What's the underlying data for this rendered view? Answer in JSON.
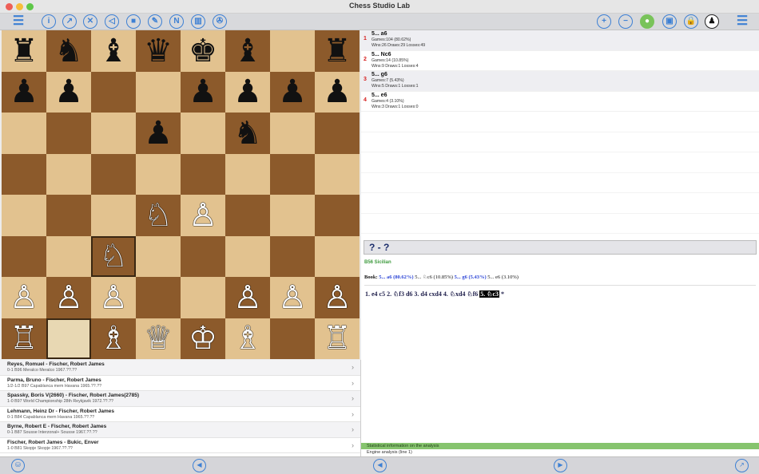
{
  "window": {
    "title": "Chess Studio Lab"
  },
  "toolbar": {
    "left": [
      {
        "name": "menu-icon",
        "glyph": "☰"
      },
      {
        "name": "info-icon",
        "glyph": "i"
      },
      {
        "name": "arrow-icon",
        "glyph": "↗"
      },
      {
        "name": "close-icon",
        "glyph": "✕"
      },
      {
        "name": "eraser-icon",
        "glyph": "◁"
      },
      {
        "name": "stop-icon",
        "glyph": "■"
      },
      {
        "name": "signature-icon",
        "glyph": "✎"
      },
      {
        "name": "notation-icon",
        "glyph": "N"
      },
      {
        "name": "book-icon",
        "glyph": "▥"
      },
      {
        "name": "wrench-icon",
        "glyph": "✇"
      }
    ],
    "right": [
      {
        "name": "zoom-in-icon",
        "glyph": "+"
      },
      {
        "name": "zoom-out-icon",
        "glyph": "−"
      },
      {
        "name": "engine-on-icon",
        "glyph": "●"
      },
      {
        "name": "window-icon",
        "glyph": "▣"
      },
      {
        "name": "lock-icon",
        "glyph": "🔒"
      },
      {
        "name": "pawn-icon",
        "glyph": "♟"
      },
      {
        "name": "sidebar-menu-icon",
        "glyph": "☰"
      }
    ]
  },
  "board": {
    "ranks": [
      [
        "♜",
        "♞",
        "♝",
        "♛",
        "♚",
        "♝",
        "",
        "♜"
      ],
      [
        "♟",
        "♟",
        "",
        "",
        "♟",
        "♟",
        "♟",
        "♟"
      ],
      [
        "",
        "",
        "",
        "♟",
        "",
        "♞",
        "",
        ""
      ],
      [
        "",
        "",
        "",
        "",
        "",
        "",
        "",
        ""
      ],
      [
        "",
        "",
        "",
        "♘",
        "♙",
        "",
        "",
        ""
      ],
      [
        "",
        "",
        "♘",
        "",
        "",
        "",
        "",
        ""
      ],
      [
        "♙",
        "♙",
        "♙",
        "",
        "",
        "♙",
        "♙",
        "♙"
      ],
      [
        "♖",
        "",
        "♗",
        "♕",
        "♔",
        "♗",
        "",
        "♖"
      ]
    ],
    "highlighted_squares": [
      "c3",
      "b1"
    ]
  },
  "games": [
    {
      "players": "Reyes, Romuel - Fischer, Robert James",
      "info": "0-1 B96 Meralco Meralco 1967.??.??"
    },
    {
      "players": "Parma, Bruno - Fischer, Robert James",
      "info": "1/2-1/2 B97 Capablanca mem Havana 1965.??.??"
    },
    {
      "players": "Spassky, Boris V(2660) - Fischer, Robert James(2785)",
      "info": "1-0 B97 World Championship 28th Reykjavik 1972.??.??"
    },
    {
      "players": "Lehmann, Heinz Dr - Fischer, Robert James",
      "info": "0-1 B84 Capablanca mem Havana 1965.??.??"
    },
    {
      "players": "Byrne, Robert E - Fischer, Robert James",
      "info": "0-1 B87 Sousse Interzonal+ Sousse 1967.??.??"
    },
    {
      "players": "Fischer, Robert James - Bukic, Enver",
      "info": "1-0 B81 Skopje Skopje 1967.??.??"
    }
  ],
  "book_moves": [
    {
      "num": "1",
      "move": "5... a6",
      "games": "Games:104 (80.62%)",
      "stats": "Wins:26 Draws:29 Losses:49"
    },
    {
      "num": "2",
      "move": "5... Nc6",
      "games": "Games:14 (10.85%)",
      "stats": "Wins:9 Draws:1 Losses:4"
    },
    {
      "num": "3",
      "move": "5... g6",
      "games": "Games:7 (5.43%)",
      "stats": "Wins:5 Draws:1 Losses:1"
    },
    {
      "num": "4",
      "move": "5... e6",
      "games": "Games:4 (3.10%)",
      "stats": "Wins:3 Draws:1 Losses:0"
    }
  ],
  "result": "? - ?",
  "eco": "B56 Sicilian",
  "book_line": {
    "label": "Book:",
    "a6": "5... a6 (80.62%)",
    "nc6": "5... ♘c6 (10.85%)",
    "g6": "5... g6 (5.43%)",
    "e6": "5... e6 (3.10%)"
  },
  "moves": {
    "text": "1. e4 c5 2. ♘f3 d6 3. d4 cxd4 4. ♘xd4 ♘f6",
    "current": "5. ♘c3",
    "tail": "*"
  },
  "status": {
    "stat": "Statistical information on the analysis",
    "engine": "Engine analysis (line 1)"
  },
  "bottom": [
    {
      "name": "database-icon",
      "glyph": "⛁"
    },
    {
      "name": "back-icon",
      "glyph": "◀"
    },
    {
      "name": "prev-icon",
      "glyph": "◀"
    },
    {
      "name": "next-icon",
      "glyph": "▶"
    },
    {
      "name": "share-icon",
      "glyph": "↗"
    }
  ],
  "colors": {
    "accent": "#3d80d4",
    "light_square": "#e2c28f",
    "dark_square": "#8c5a2b",
    "stat_bar": "#86c46e",
    "move_number": "#d61f1f"
  }
}
